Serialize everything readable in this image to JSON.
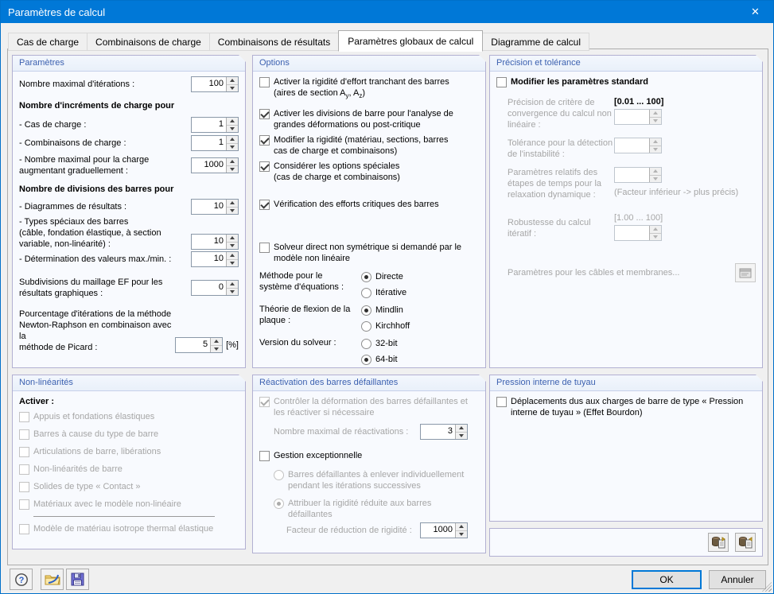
{
  "window": {
    "title": "Paramètres de calcul"
  },
  "icons": {
    "close": "✕",
    "help": "?",
    "open": "open-folder",
    "save": "floppy-disk",
    "cables": "dialog-window",
    "copy_params": "barrel-document",
    "paste_params": "barrel-document"
  },
  "colors": {
    "titlebar": "#0078D7",
    "accent": "#0078D7",
    "panel_border": "#B2B0D2",
    "panel_bg": "#F8FAFE",
    "header_text": "#3C61B0",
    "dialog_bg": "#F0F0F0",
    "disabled_text": "#A6A6A6"
  },
  "tabs": [
    {
      "label": "Cas de charge",
      "active": false
    },
    {
      "label": "Combinaisons de charge",
      "active": false
    },
    {
      "label": "Combinaisons de résultats",
      "active": false
    },
    {
      "label": "Paramètres globaux de calcul",
      "active": true
    },
    {
      "label": "Diagramme de calcul",
      "active": false
    }
  ],
  "parametres": {
    "title": "Paramètres",
    "max_iterations_label": "Nombre maximal d'itérations :",
    "max_iterations_value": "100",
    "increments_heading": "Nombre d'incréments de charge pour",
    "inc_cas_label": "- Cas de charge :",
    "inc_cas_value": "1",
    "inc_comb_label": "- Combinaisons de charge :",
    "inc_comb_value": "1",
    "inc_max_label": "- Nombre maximal pour la charge\naugmentant graduellement :",
    "inc_max_value": "1000",
    "divisions_heading": "Nombre de divisions des barres pour",
    "div_diag_label": "- Diagrammes de résultats :",
    "div_diag_value": "10",
    "div_types_label": "- Types spéciaux des barres\n  (câble, fondation élastique, à section\n  variable, non-linéarité) :",
    "div_types_value": "10",
    "div_max_label": "- Détermination des valeurs max./min. :",
    "div_max_value": "10",
    "subdiv_label": "Subdivisions du maillage EF pour les\nrésultats graphiques :",
    "subdiv_value": "0",
    "picard_label": "Pourcentage d'itérations de la méthode\nNewton-Raphson en combinaison avec la\nméthode de Picard :",
    "picard_value": "5",
    "picard_unit": "[%]"
  },
  "options": {
    "title": "Options",
    "cb_shear": {
      "checked": false,
      "line1": "Activer la rigidité d'effort tranchant des barres",
      "line2_pre": "(aires de section A",
      "sub1": "y",
      "mid": ", A",
      "sub2": "z",
      "post": ")"
    },
    "cb_divisions": {
      "checked": true,
      "label": "Activer les divisions de barre pour l'analyse de\ngrandes déformations ou post-critique"
    },
    "cb_rigidite": {
      "checked": true,
      "label": "Modifier la rigidité (matériau, sections, barres\ncas de charge et combinaisons)"
    },
    "cb_options_speciales": {
      "checked": true,
      "label": "Considérer les options spéciales\n(cas de charge et combinaisons)"
    },
    "cb_verification": {
      "checked": true,
      "label": "Vérification des efforts critiques des barres"
    },
    "cb_solveur": {
      "checked": false,
      "label": "Solveur direct non symétrique si demandé par le\nmodèle non linéaire"
    },
    "methode_label": "Méthode pour le\nsystème d'équations :",
    "methode_options": [
      {
        "label": "Directe",
        "selected": true
      },
      {
        "label": "Itérative",
        "selected": false
      }
    ],
    "flexion_label": "Théorie de flexion de la\nplaque :",
    "flexion_options": [
      {
        "label": "Mindlin",
        "selected": true
      },
      {
        "label": "Kirchhoff",
        "selected": false
      }
    ],
    "solveur_label": "Version du solveur :",
    "solveur_options": [
      {
        "label": "32-bit",
        "selected": false
      },
      {
        "label": "64-bit",
        "selected": true
      }
    ]
  },
  "precision": {
    "title": "Précision et tolérance",
    "cb_modifier": {
      "checked": false,
      "label": "Modifier les paramètres standard"
    },
    "convergence_label": "Précision de critère de\nconvergence du calcul non\nlinéaire :",
    "convergence_hint": "[0.01 ... 100]",
    "convergence_value": "",
    "tolerance_label": "Tolérance pour la détection\nde l'instabilité :",
    "tolerance_value": "",
    "relaxation_label": "Paramètres relatifs des\nétapes de temps pour la\nrelaxation dynamique :",
    "relaxation_value": "",
    "relaxation_note": "(Facteur inférieur -> plus précis)",
    "robustesse_label": "Robustesse du calcul itératif :",
    "robustesse_hint": "[1.00 ... 100]",
    "robustesse_value": "",
    "cables_label": "Paramètres pour les câbles et membranes..."
  },
  "nonlinearites": {
    "title": "Non-linéarités",
    "activer_label": "Activer :",
    "items": [
      "Appuis et fondations élastiques",
      "Barres à cause du type de barre",
      "Articulations de barre, libérations",
      "Non-linéarités de barre",
      "Solides de type « Contact »",
      "Matériaux avec le modèle non-linéaire"
    ],
    "extra_item": "Modèle de matériau isotrope thermal élastique"
  },
  "reactivation": {
    "title": "Réactivation des barres défaillantes",
    "cb_controler": {
      "checked": true,
      "label": "Contrôler la déformation des barres défaillantes et\nles réactiver si nécessaire"
    },
    "max_reactivations_label": "Nombre maximal de réactivations :",
    "max_reactivations_value": "3",
    "cb_gestion": {
      "checked": false,
      "label": "Gestion exceptionnelle"
    },
    "radio_enlever": {
      "selected": false,
      "label": "Barres défaillantes à enlever individuellement\npendant les itérations successives"
    },
    "radio_attribuer": {
      "selected": true,
      "label": "Attribuer la rigidité réduite aux barres\ndéfaillantes"
    },
    "facteur_label": "Facteur de réduction de rigidité :",
    "facteur_value": "1000"
  },
  "pression": {
    "title": "Pression interne de tuyau",
    "cb_bourdon": {
      "checked": false,
      "label": "Déplacements dus aux charges de barre de type « Pression\ninterne de tuyau » (Effet Bourdon)"
    }
  },
  "footer": {
    "ok": "OK",
    "cancel": "Annuler"
  }
}
